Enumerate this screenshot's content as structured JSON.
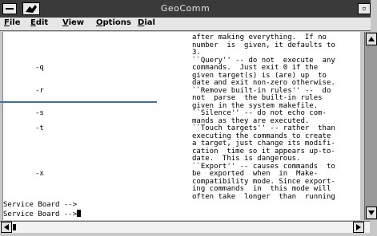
{
  "window": {
    "title": "GeoComm",
    "maximize_glyph": "▫"
  },
  "menu": [
    {
      "label": "File",
      "underline": "F",
      "rest": "ile"
    },
    {
      "label": "Edit",
      "underline": "E",
      "rest": "dit"
    },
    {
      "label": "View",
      "underline": "V",
      "rest": "iew"
    },
    {
      "label": "Options",
      "underline": "O",
      "rest": "ptions"
    },
    {
      "label": "Dial",
      "underline": "D",
      "rest": "ial"
    }
  ],
  "terminal": {
    "lines": [
      {
        "opt": "",
        "text": "after making everything.  If no"
      },
      {
        "opt": "",
        "text": "number  is  given, it defaults to"
      },
      {
        "opt": "",
        "text": "3."
      },
      {
        "opt": "",
        "text": "``Query'' -- do not  execute  any"
      },
      {
        "opt": "-q",
        "text": "commands.  Just exit 0 if the"
      },
      {
        "opt": "",
        "text": "given target(s) is (are) up  to"
      },
      {
        "opt": "",
        "text": "date and exit non-zero otherwise."
      },
      {
        "opt": "-r",
        "text": "``Remove built-in rules'' --  do"
      },
      {
        "opt": "",
        "text": "not  parse  the built-in rules"
      },
      {
        "opt": "",
        "text": "given in the system makefile."
      },
      {
        "opt": "-s",
        "text": "``Silence'' -- do not echo com-"
      },
      {
        "opt": "",
        "text": "mands as they are executed."
      },
      {
        "opt": "-t",
        "text": "``Touch targets'' -- rather  than"
      },
      {
        "opt": "",
        "text": "executing the commands to create"
      },
      {
        "opt": "",
        "text": "a target, just change its modifi-"
      },
      {
        "opt": "",
        "text": "cation  time so it appears up-to-"
      },
      {
        "opt": "",
        "text": "date.  This is dangerous."
      },
      {
        "opt": "",
        "text": "``Export'' -- causes commands  to"
      },
      {
        "opt": "-x",
        "text": "be  exported  when  in  Make-"
      },
      {
        "opt": "",
        "text": "compatibility mode. Since export-"
      },
      {
        "opt": "",
        "text": "ing commands  in  this mode will"
      },
      {
        "opt": "",
        "text": "often take  longer  than  running"
      }
    ],
    "prompts": [
      "Service Board -->",
      "Service Board -->"
    ]
  },
  "colors": {
    "title_bg": "#3a3a3a",
    "terminal_bg": "#ffffff",
    "highlight_line": "#3a6fb0"
  }
}
